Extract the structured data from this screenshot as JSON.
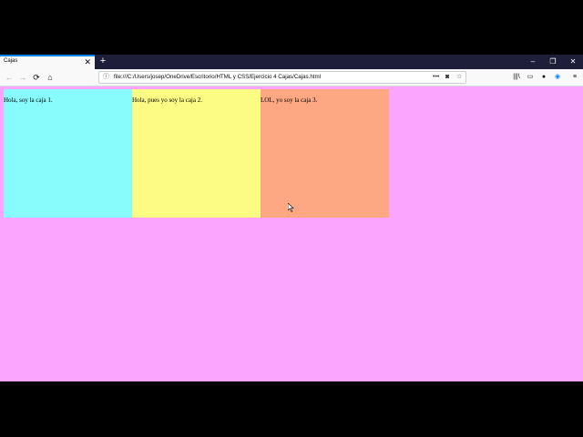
{
  "browser": {
    "tab": {
      "title": "Cajas",
      "close": "✕"
    },
    "newtab": "+",
    "window_controls": {
      "minimize": "–",
      "restore": "❐",
      "close": "✕"
    },
    "nav": {
      "back": "←",
      "forward": "→",
      "reload": "⟳",
      "home": "⌂"
    },
    "url": "file:///C:/Users/josep/OneDrive/Escritorio/HTML y CSS/Ejercicio 4 Cajas/Cajas.html",
    "url_icons": {
      "info": "ⓘ",
      "more": "•••",
      "pocket": "◙",
      "bookmark": "☆"
    },
    "toolbar_icons": {
      "library": "|||\\",
      "sidebar": "▭",
      "account": "●",
      "extension": "◉",
      "menu": "≡"
    }
  },
  "page": {
    "boxes": [
      {
        "text": "Hola, soy la caja 1.",
        "color": "#88fbfd"
      },
      {
        "text": "Hola, pues yo soy la caja 2.",
        "color": "#fcfb84"
      },
      {
        "text": "LOL, yo soy la caja 3.",
        "color": "#fda883"
      }
    ],
    "background": "#fca5fe"
  }
}
